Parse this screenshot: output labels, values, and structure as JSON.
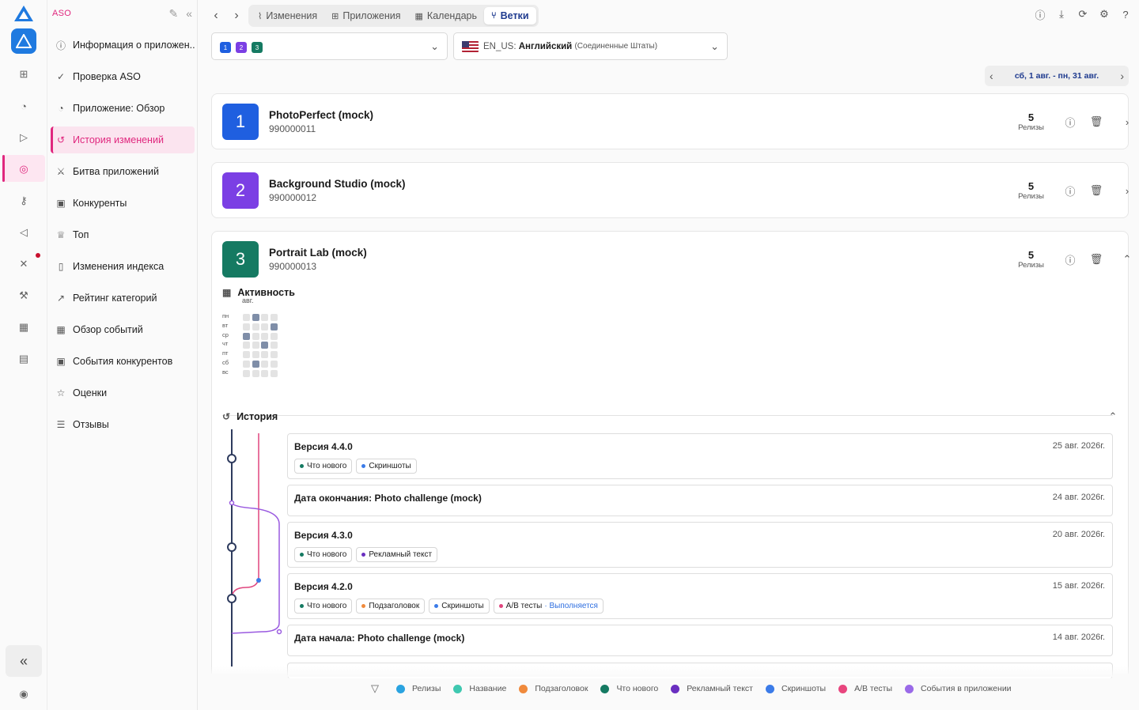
{
  "sidebar": {
    "app_label": "ASO",
    "items": [
      {
        "label": "Информация о приложен...",
        "icon": "info-icon"
      },
      {
        "label": "Проверка ASO",
        "icon": "check-circle-icon"
      },
      {
        "label": "Приложение: Обзор",
        "icon": "pie-chart-icon"
      },
      {
        "label": "История изменений",
        "icon": "history-icon",
        "active": true
      },
      {
        "label": "Битва приложений",
        "icon": "battle-icon"
      },
      {
        "label": "Конкуренты",
        "icon": "competitors-icon"
      },
      {
        "label": "Топ",
        "icon": "trophy-icon"
      },
      {
        "label": "Изменения индекса",
        "icon": "phone-icon"
      },
      {
        "label": "Рейтинг категорий",
        "icon": "trend-up-icon"
      },
      {
        "label": "Обзор событий",
        "icon": "calendar-icon"
      },
      {
        "label": "События конкурентов",
        "icon": "competitor-events-icon"
      },
      {
        "label": "Оценки",
        "icon": "star-icon"
      },
      {
        "label": "Отзывы",
        "icon": "reviews-icon"
      }
    ]
  },
  "tabs": [
    {
      "label": "Изменения",
      "icon": "chart-line-icon"
    },
    {
      "label": "Приложения",
      "icon": "apps-grid-icon"
    },
    {
      "label": "Календарь",
      "icon": "calendar-icon"
    },
    {
      "label": "Ветки",
      "icon": "branch-icon",
      "active": true
    }
  ],
  "app_selector": {
    "chips": [
      "1",
      "2",
      "3"
    ],
    "chip_colors": [
      "#1f5fe0",
      "#7b3fe4",
      "#157a62"
    ]
  },
  "locale_selector": {
    "code": "EN_US:",
    "language": "Английский",
    "region": "(Соединенные Штаты)"
  },
  "date_range": "сб, 1 авг. - пн, 31 авг.",
  "apps": [
    {
      "num": "1",
      "name": "PhotoPerfect (mock)",
      "id": "990000011",
      "releases": "5",
      "releases_label": "Релизы",
      "color": "#1f5fe0"
    },
    {
      "num": "2",
      "name": "Background Studio (mock)",
      "id": "990000012",
      "releases": "5",
      "releases_label": "Релизы",
      "color": "#7b3fe4"
    },
    {
      "num": "3",
      "name": "Portrait Lab (mock)",
      "id": "990000013",
      "releases": "5",
      "releases_label": "Релизы",
      "color": "#157a62",
      "expanded": true
    }
  ],
  "activity": {
    "title": "Активность",
    "month": "авг.",
    "days": [
      "пн",
      "вт",
      "ср",
      "чт",
      "пт",
      "сб",
      "вс"
    ]
  },
  "history": {
    "title": "История",
    "entries": [
      {
        "title": "Версия 4.4.0",
        "date": "25 авг. 2026г.",
        "tags": [
          {
            "label": "Что нового",
            "color": "#157a62"
          },
          {
            "label": "Скриншоты",
            "color": "#3b7be8"
          }
        ]
      },
      {
        "title": "Дата окончания: Photo challenge (mock)",
        "date": "24 авг. 2026г.",
        "tags": []
      },
      {
        "title": "Версия 4.3.0",
        "date": "20 авг. 2026г.",
        "tags": [
          {
            "label": "Что нового",
            "color": "#157a62"
          },
          {
            "label": "Рекламный текст",
            "color": "#6a2fc0"
          }
        ]
      },
      {
        "title": "Версия 4.2.0",
        "date": "15 авг. 2026г.",
        "tags": [
          {
            "label": "Что нового",
            "color": "#157a62"
          },
          {
            "label": "Подзаголовок",
            "color": "#f08a3c"
          },
          {
            "label": "Скриншоты",
            "color": "#3b7be8"
          },
          {
            "label": "A/B тесты",
            "color": "#e0457e",
            "suffix": "· Выполняется"
          }
        ]
      },
      {
        "title": "Дата начала: Photo challenge (mock)",
        "date": "14 авг. 2026г.",
        "tags": []
      }
    ]
  },
  "legend": [
    {
      "label": "Релизы",
      "color": "#2aa3e0"
    },
    {
      "label": "Название",
      "color": "#3fc8b0"
    },
    {
      "label": "Подзаголовок",
      "color": "#f08a3c"
    },
    {
      "label": "Что нового",
      "color": "#157a62"
    },
    {
      "label": "Рекламный текст",
      "color": "#6a2fc0"
    },
    {
      "label": "Скриншоты",
      "color": "#3b7be8"
    },
    {
      "label": "A/B тесты",
      "color": "#e8457e"
    },
    {
      "label": "События в приложении",
      "color": "#9a6ae8"
    }
  ]
}
